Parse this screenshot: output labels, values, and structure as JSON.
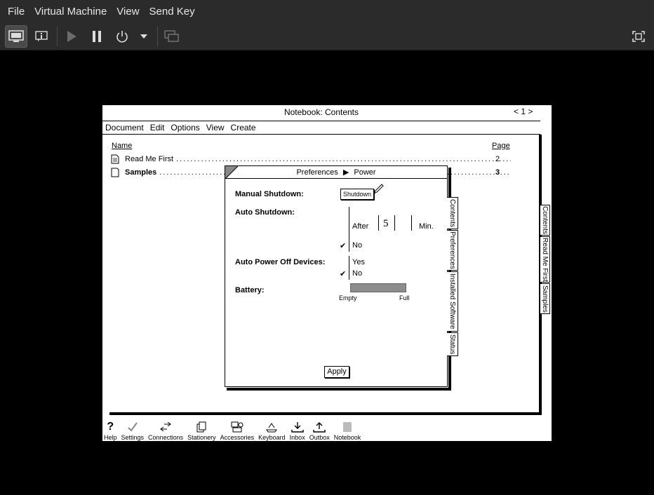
{
  "host": {
    "menu": [
      "File",
      "Virtual Machine",
      "View",
      "Send Key"
    ],
    "toolbar": {
      "console_icon": "monitor-icon",
      "details_icon": "info-icon",
      "run_icon": "play-icon",
      "pause_icon": "pause-icon",
      "power_icon": "power-icon",
      "power_menu_icon": "chevron-down-icon",
      "snapshots_icon": "snapshot-icon",
      "fullscreen_icon": "fullscreen-icon"
    }
  },
  "notebook": {
    "title": "Notebook: Contents",
    "pager": "< 1 >",
    "menu": [
      "Document",
      "Edit",
      "Options",
      "View",
      "Create"
    ],
    "columns": {
      "name": "Name",
      "page": "Page"
    },
    "rows": [
      {
        "name": "Read Me First",
        "page": "2",
        "bold": false
      },
      {
        "name": "Samples",
        "page": "3",
        "bold": true
      }
    ],
    "side_tabs": [
      "Contents",
      "Read Me First",
      "Samples"
    ]
  },
  "preferences": {
    "title": "Preferences",
    "section": "Power",
    "manual_shutdown_label": "Manual Shutdown:",
    "shutdown_button": "Shutdown",
    "auto_shutdown_label": "Auto Shutdown:",
    "after_label": "After",
    "minutes_value": "5",
    "min_label": "Min.",
    "auto_shutdown_no": "No",
    "auto_power_off_label": "Auto Power Off Devices:",
    "auto_power_off_yes": "Yes",
    "auto_power_off_no": "No",
    "battery_label": "Battery:",
    "battery_empty": "Empty",
    "battery_full": "Full",
    "battery_level": 1.0,
    "apply_button": "Apply",
    "tabs": [
      "Contents",
      "Preferences",
      "Installed Software",
      "Status"
    ]
  },
  "bookshelf": [
    {
      "label": "Help",
      "icon": "question-icon"
    },
    {
      "label": "Settings",
      "icon": "checkmark-icon"
    },
    {
      "label": "Connections",
      "icon": "connections-icon"
    },
    {
      "label": "Stationery",
      "icon": "stationery-icon"
    },
    {
      "label": "Accessories",
      "icon": "accessories-icon"
    },
    {
      "label": "Keyboard",
      "icon": "keyboard-icon"
    },
    {
      "label": "Inbox",
      "icon": "inbox-icon"
    },
    {
      "label": "Outbox",
      "icon": "outbox-icon"
    },
    {
      "label": "Notebook",
      "icon": "notebook-icon"
    }
  ]
}
